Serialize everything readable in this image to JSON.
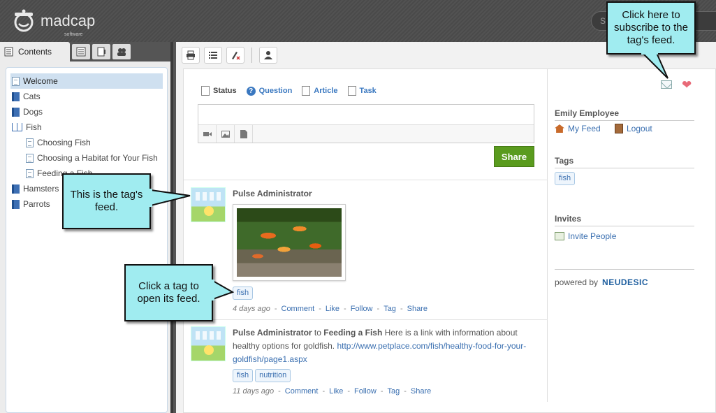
{
  "header": {
    "brand": "madcap",
    "brand_sub": "software",
    "search_placeholder": "S"
  },
  "left_panel": {
    "tabs": [
      {
        "label": "Contents",
        "icon": "contents-icon"
      },
      {
        "icon": "index-icon"
      },
      {
        "icon": "glossary-icon"
      },
      {
        "icon": "browse-icon"
      }
    ],
    "tree": [
      {
        "label": "Welcome",
        "type": "page",
        "selected": true
      },
      {
        "label": "Cats",
        "type": "book"
      },
      {
        "label": "Dogs",
        "type": "book"
      },
      {
        "label": "Fish",
        "type": "open-book"
      },
      {
        "label": "Choosing Fish",
        "type": "page",
        "child": true
      },
      {
        "label": "Choosing a Habitat for Your Fish",
        "type": "page",
        "child": true
      },
      {
        "label": "Feeding a Fish",
        "type": "page",
        "child": true
      },
      {
        "label": "Hamsters",
        "type": "book"
      },
      {
        "label": "Parrots",
        "type": "book"
      }
    ]
  },
  "toolbar": {
    "buttons": [
      "print-icon",
      "toc-icon",
      "clear-highlight-icon",
      "login-icon"
    ]
  },
  "composer": {
    "tabs": [
      {
        "label": "Status",
        "active": true
      },
      {
        "label": "Question"
      },
      {
        "label": "Article"
      },
      {
        "label": "Task"
      }
    ],
    "share_label": "Share"
  },
  "posts": [
    {
      "author": "Pulse Administrator",
      "tags": [
        "fish"
      ],
      "time": "4 days ago",
      "actions": [
        "Comment",
        "Like",
        "Follow",
        "Tag",
        "Share"
      ]
    },
    {
      "author": "Pulse Administrator",
      "connector": "to",
      "target": "Feeding a Fish",
      "text": "Here is a link with information about healthy options for goldfish.",
      "link": "http://www.petplace.com/fish/healthy-food-for-your-goldfish/page1.aspx",
      "tags": [
        "fish",
        "nutrition"
      ],
      "time": "11 days ago",
      "actions": [
        "Comment",
        "Like",
        "Follow",
        "Tag",
        "Share"
      ]
    }
  ],
  "side": {
    "user_name": "Emily Employee",
    "my_feed": "My Feed",
    "logout": "Logout",
    "tags_heading": "Tags",
    "tags": [
      "fish"
    ],
    "invites_heading": "Invites",
    "invite_people": "Invite People",
    "powered_by": "powered by",
    "powered_brand": "NEUDESIC"
  },
  "callouts": {
    "subscribe": "Click here to subscribe to the tag's feed.",
    "tag_feed": "This is the tag's feed.",
    "click_tag": "Click a tag to open its feed."
  },
  "colors": {
    "accent_blue": "#3a6fb0",
    "share_green": "#5a9b1e",
    "callout_bg": "#a0ecf0"
  }
}
